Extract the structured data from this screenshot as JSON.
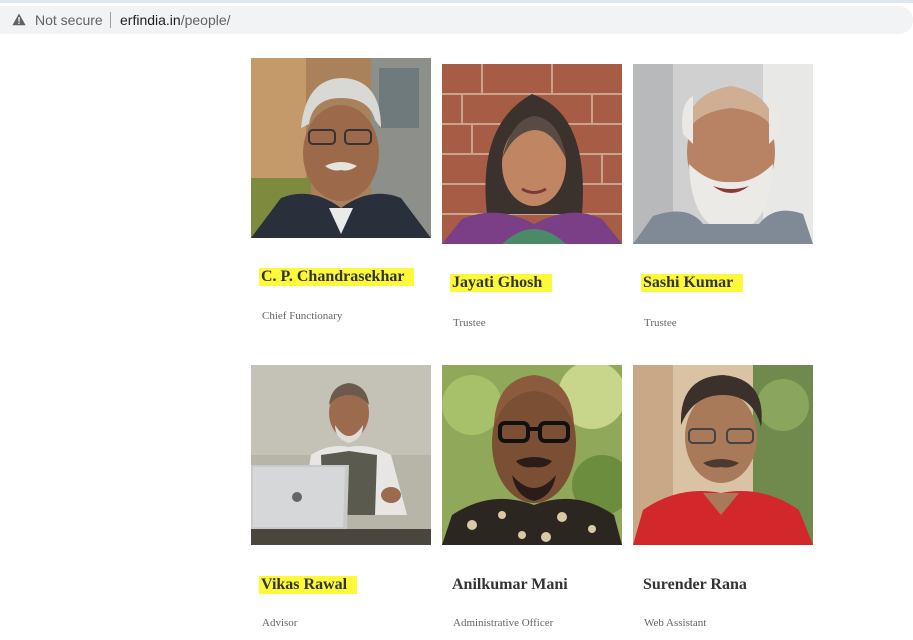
{
  "browser": {
    "security_label": "Not secure",
    "url_host": "erfindia.in",
    "url_path": "/people/"
  },
  "people": [
    {
      "name": "C. P. Chandrasekhar",
      "role": "Chief Functionary",
      "highlighted": true
    },
    {
      "name": "Jayati Ghosh",
      "role": "Trustee",
      "highlighted": true
    },
    {
      "name": "Sashi Kumar",
      "role": "Trustee",
      "highlighted": true
    },
    {
      "name": "Vikas Rawal",
      "role": "Advisor",
      "highlighted": true
    },
    {
      "name": "Anilkumar Mani",
      "role": "Administrative Officer",
      "highlighted": false
    },
    {
      "name": "Surender Rana",
      "role": "Web Assistant",
      "highlighted": false
    }
  ],
  "colors": {
    "highlight": "#fbf93a",
    "name_text": "#333333",
    "role_text": "#666666"
  }
}
